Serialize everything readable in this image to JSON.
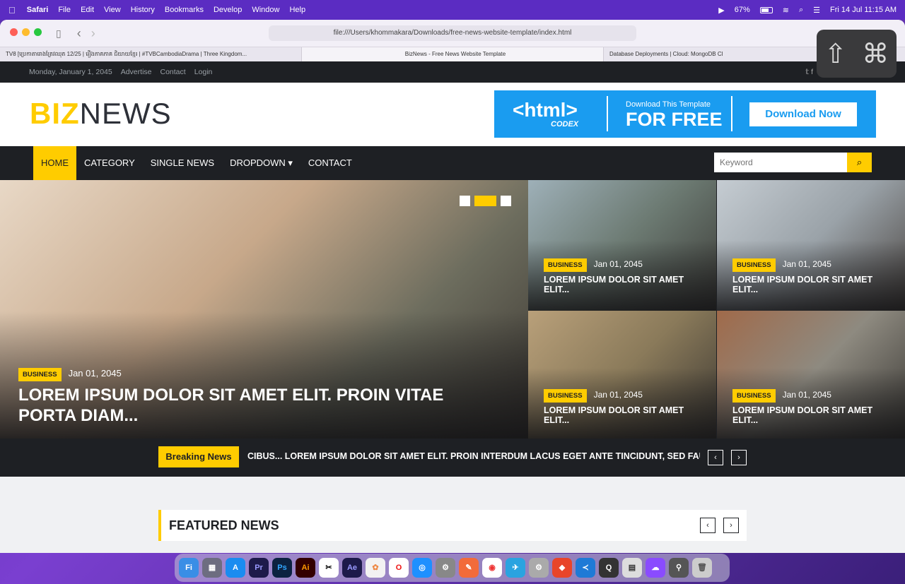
{
  "menubar": {
    "app": "Safari",
    "items": [
      "File",
      "Edit",
      "View",
      "History",
      "Bookmarks",
      "Develop",
      "Window",
      "Help"
    ],
    "battery": "67%",
    "datetime": "Fri 14 Jul  11:15 AM"
  },
  "browser": {
    "url": "file:///Users/khommakara/Downloads/free-news-website-template/index.html",
    "tabs": [
      "TV8 [ប្រេកាតារោងត្រែវឈុត 12/25 | រឿងភាគភាគ ជិយាយខ្មែរ | #TVBCambodiaDrama | Three Kingdom...",
      "BizNews - Free News Website Template",
      "Database Deployments | Cloud: MongoDB Cl"
    ]
  },
  "topbar": {
    "date": "Monday, January 1, 2045",
    "links": [
      "Advertise",
      "Contact",
      "Login"
    ],
    "social": "𝕥  f"
  },
  "logo": {
    "biz": "BIZ",
    "news": "NEWS"
  },
  "banner": {
    "html": "<html>",
    "codex": "CODEX",
    "line1": "Download This Template",
    "line2": "FOR FREE",
    "button": "Download Now"
  },
  "nav": {
    "items": [
      "HOME",
      "CATEGORY",
      "SINGLE NEWS",
      "DROPDOWN ▾",
      "CONTACT"
    ],
    "search_placeholder": "Keyword"
  },
  "hero": {
    "big": {
      "badge": "BUSINESS",
      "date": "Jan 01, 2045",
      "title": "LOREM IPSUM DOLOR SIT AMET ELIT. PROIN VITAE PORTA DIAM..."
    },
    "small": [
      {
        "badge": "BUSINESS",
        "date": "Jan 01, 2045",
        "title": "LOREM IPSUM DOLOR SIT AMET ELIT..."
      },
      {
        "badge": "BUSINESS",
        "date": "Jan 01, 2045",
        "title": "LOREM IPSUM DOLOR SIT AMET ELIT..."
      },
      {
        "badge": "BUSINESS",
        "date": "Jan 01, 2045",
        "title": "LOREM IPSUM DOLOR SIT AMET ELIT..."
      },
      {
        "badge": "BUSINESS",
        "date": "Jan 01, 2045",
        "title": "LOREM IPSUM DOLOR SIT AMET ELIT..."
      }
    ]
  },
  "breaking": {
    "label": "Breaking News",
    "text": "CIBUS... LOREM IPSUM DOLOR SIT AMET ELIT. PROIN INTERDUM LACUS EGET ANTE TINCIDUNT, SED FAUC",
    "prev": "‹",
    "next": "›"
  },
  "featured": {
    "title": "FEATURED NEWS",
    "prev": "‹",
    "next": "›"
  },
  "overlay": {
    "shift": "⇧",
    "cmd": "⌘"
  },
  "dock": [
    "Fi",
    "▦",
    "A",
    "Pr",
    "Ps",
    "Ai",
    "✂",
    "Ae",
    "✿",
    "O",
    "◎",
    "⚙",
    "✎",
    "◉",
    "✈",
    "⚙",
    "◆",
    "≺",
    "Q",
    "▤",
    "☁",
    "⚲",
    "🗑"
  ]
}
